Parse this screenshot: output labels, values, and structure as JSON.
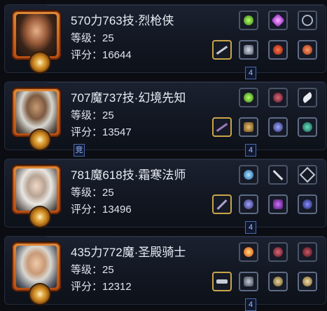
{
  "players": [
    {
      "name": "570力763技·烈枪侠",
      "level_label": "等级：25",
      "score_label": "评分：16644",
      "badge": "4",
      "extra_badge": ""
    },
    {
      "name": "707魔737技·幻境先知",
      "level_label": "等级：25",
      "score_label": "评分：13547",
      "badge": "4",
      "extra_badge": "竞"
    },
    {
      "name": "781魔618技·霜寒法师",
      "level_label": "等级：25",
      "score_label": "评分：13496",
      "badge": "4",
      "extra_badge": ""
    },
    {
      "name": "435力772魔·圣殿骑士",
      "level_label": "等级：25",
      "score_label": "评分：12312",
      "badge": "4",
      "extra_badge": ""
    }
  ],
  "colors": {
    "portrait_frame": "#d06a20",
    "slot_gold": "#c9a548",
    "slot_silver": "#5e6b85",
    "badge_blue": "#4b6ab0"
  },
  "icons": [
    "green-potion-icon",
    "purple-gem-icon",
    "necklace-icon",
    "sword-icon",
    "armor-icon",
    "red-shield-icon",
    "ring-icon",
    "staff-icon",
    "robe-icon",
    "dark-gem-icon",
    "boots-icon",
    "orb-icon",
    "wand-icon",
    "rune-icon",
    "fire-icon",
    "hammer-icon",
    "gauntlet-icon",
    "helmet-icon",
    "shield-icon"
  ]
}
